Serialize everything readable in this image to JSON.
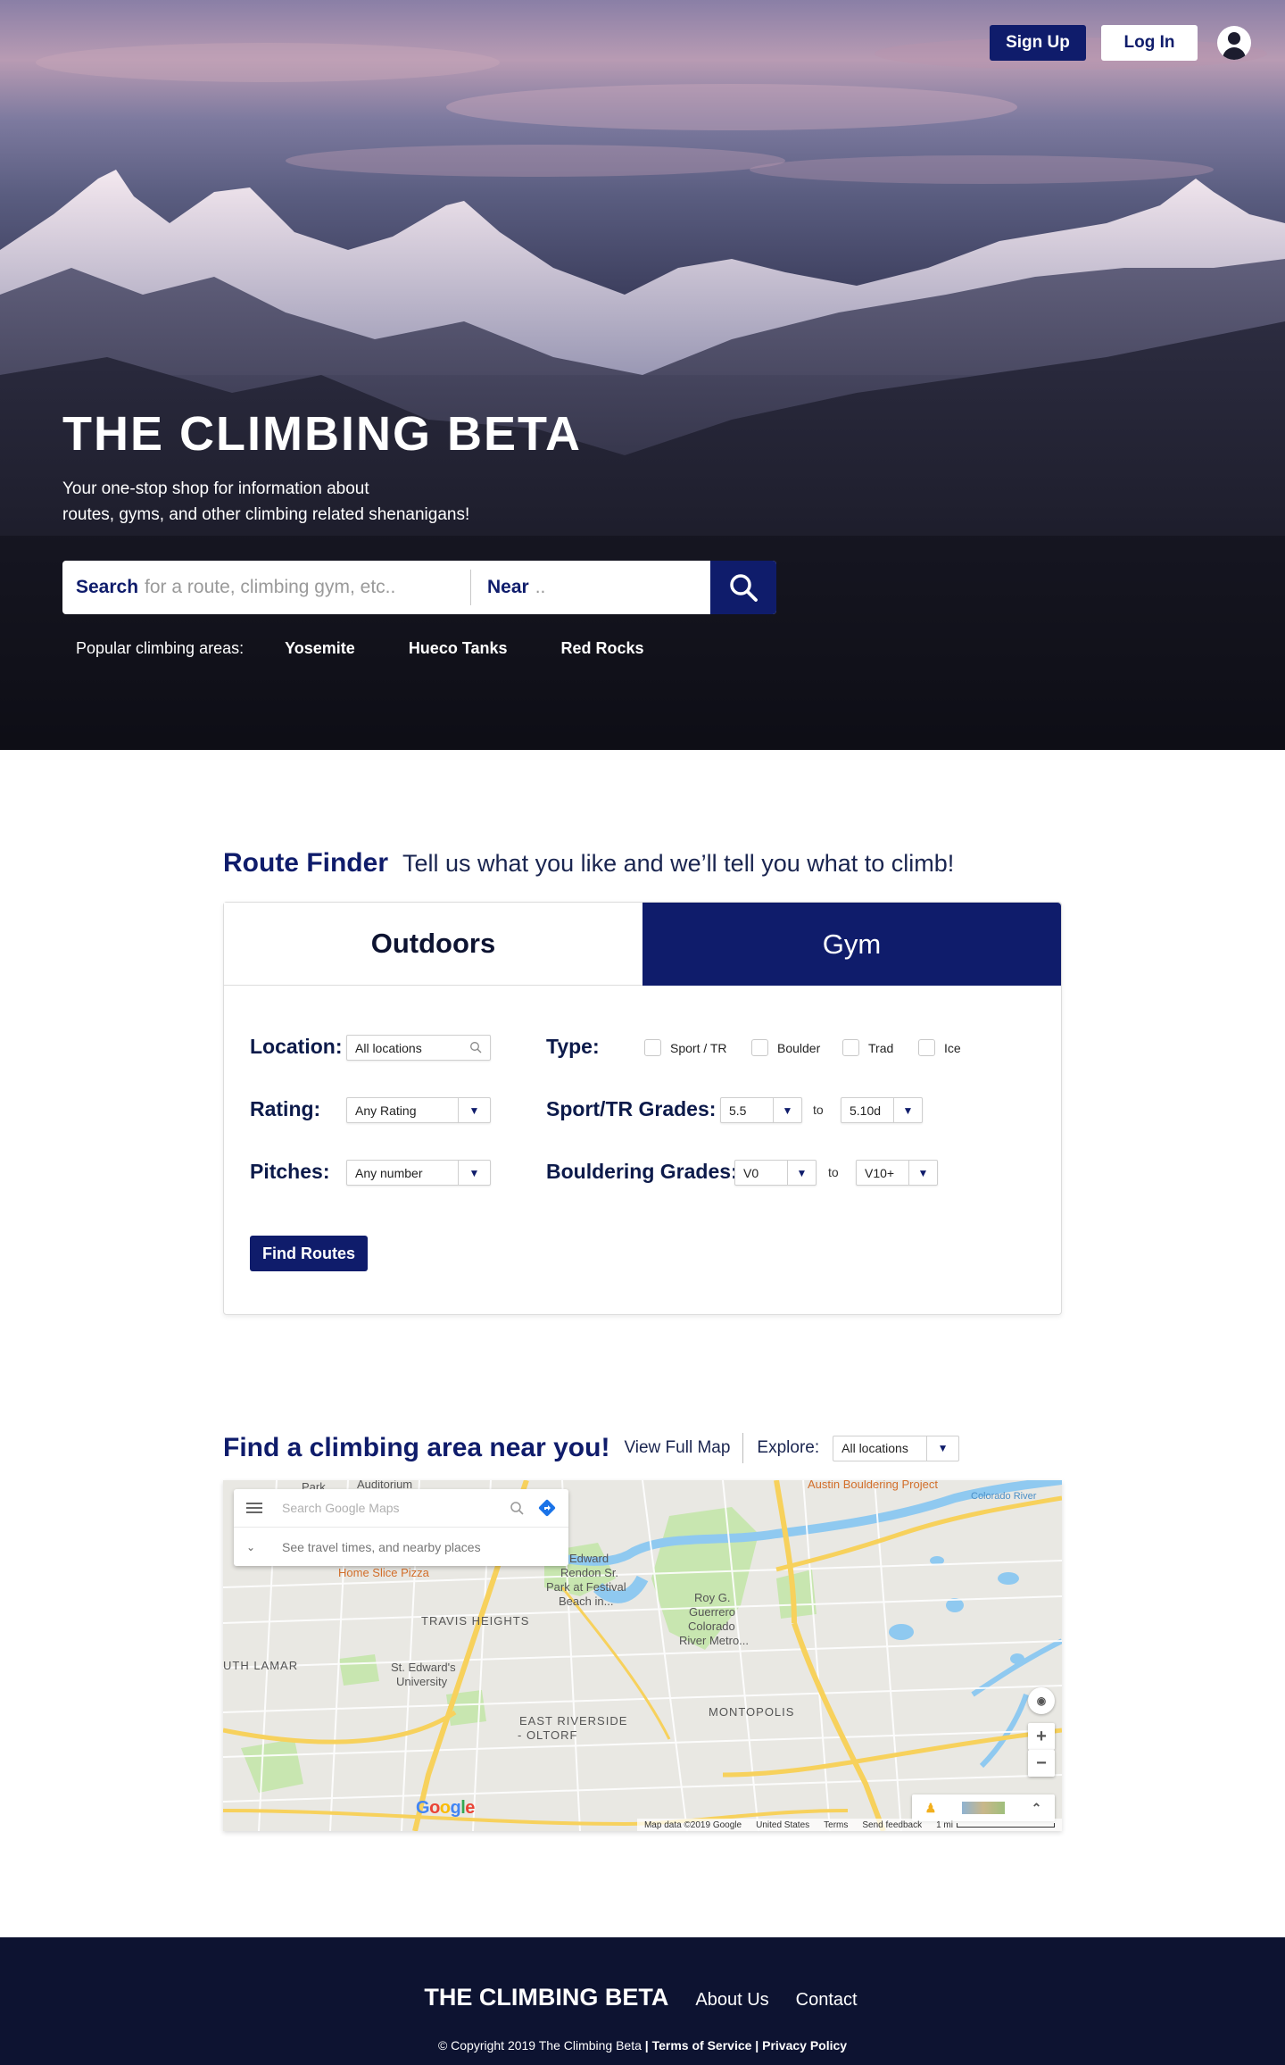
{
  "header": {
    "signup_label": "Sign Up",
    "login_label": "Log In",
    "avatar_icon": "user-avatar-icon"
  },
  "hero": {
    "title": "THE CLIMBING BETA",
    "subtitle_line1": "Your one-stop shop for information about",
    "subtitle_line2": "routes, gyms, and other climbing related shenanigans!",
    "search": {
      "what_label": "Search",
      "what_placeholder": "for a route, climbing gym, etc..",
      "near_label": "Near",
      "near_placeholder": "..",
      "button_icon": "search-icon"
    },
    "popular": {
      "label": "Popular climbing areas:",
      "areas": [
        "Yosemite",
        "Hueco Tanks",
        "Red Rocks"
      ]
    }
  },
  "route_finder": {
    "title": "Route Finder",
    "tagline": "Tell us what you like and we’ll tell you what to climb!",
    "tabs": [
      "Outdoors",
      "Gym"
    ],
    "active_tab": "Gym",
    "location_label": "Location:",
    "location_value": "All locations",
    "rating_label": "Rating:",
    "rating_value": "Any Rating",
    "pitches_label": "Pitches:",
    "pitches_value": "Any number",
    "type_label": "Type:",
    "types": [
      "Sport / TR",
      "Boulder",
      "Trad",
      "Ice"
    ],
    "sport_label": "Sport/TR Grades:",
    "sport_from": "5.5",
    "sport_to": "5.10d",
    "boulder_label": "Bouldering Grades:",
    "boulder_from": "V0",
    "boulder_to": "V10+",
    "to_word": "to",
    "find_button": "Find Routes"
  },
  "map_section": {
    "title": "Find a climbing area near you!",
    "view_full_map": "View Full Map",
    "explore_label": "Explore:",
    "explore_value": "All locations",
    "map": {
      "search_placeholder": "Search Google Maps",
      "travel_hint": "See travel times, and nearby places",
      "labels": {
        "travis_heights": "TRAVIS HEIGHTS",
        "east_riverside": "EAST RIVERSIDE",
        "oltorf": "- OLTORF",
        "montopolis": "MONTOPOLIS",
        "lamar": "UTH LAMAR",
        "st_edwards": "St. Edward's",
        "university": "University",
        "edward_rendon": "Edward",
        "rendon_sr": "Rendon Sr.",
        "park_festival": "Park at Festival",
        "beach": "Beach in...",
        "roy_g": "Roy G.",
        "guerrero": "Guerrero",
        "colorado": "Colorado",
        "river_metro": "River Metro...",
        "home_slice": "Home Slice Pizza",
        "park": "Park",
        "auditorium": "Auditorium",
        "austin_bouldering": "Austin Bouldering Project",
        "colorado_river": "Colorado River"
      },
      "footer": {
        "map_data": "Map data ©2019 Google",
        "country": "United States",
        "terms": "Terms",
        "feedback": "Send feedback",
        "scale": "1 mi"
      },
      "google_logo": "Google"
    }
  },
  "footer": {
    "brand": "THE CLIMBING BETA",
    "about": "About Us",
    "contact": "Contact",
    "copyright": "© Copyright 2019 The Climbing Beta",
    "terms": "Terms of Service",
    "privacy": "Privacy Policy",
    "separator": "|"
  },
  "colors": {
    "navy": "#0f1c6b",
    "footer_bg": "#0d1331",
    "map_bg": "#e9e8e3",
    "park_green": "#c8e6b0",
    "water_blue": "#8fc9f0",
    "highway_yellow": "#f7d15c"
  }
}
